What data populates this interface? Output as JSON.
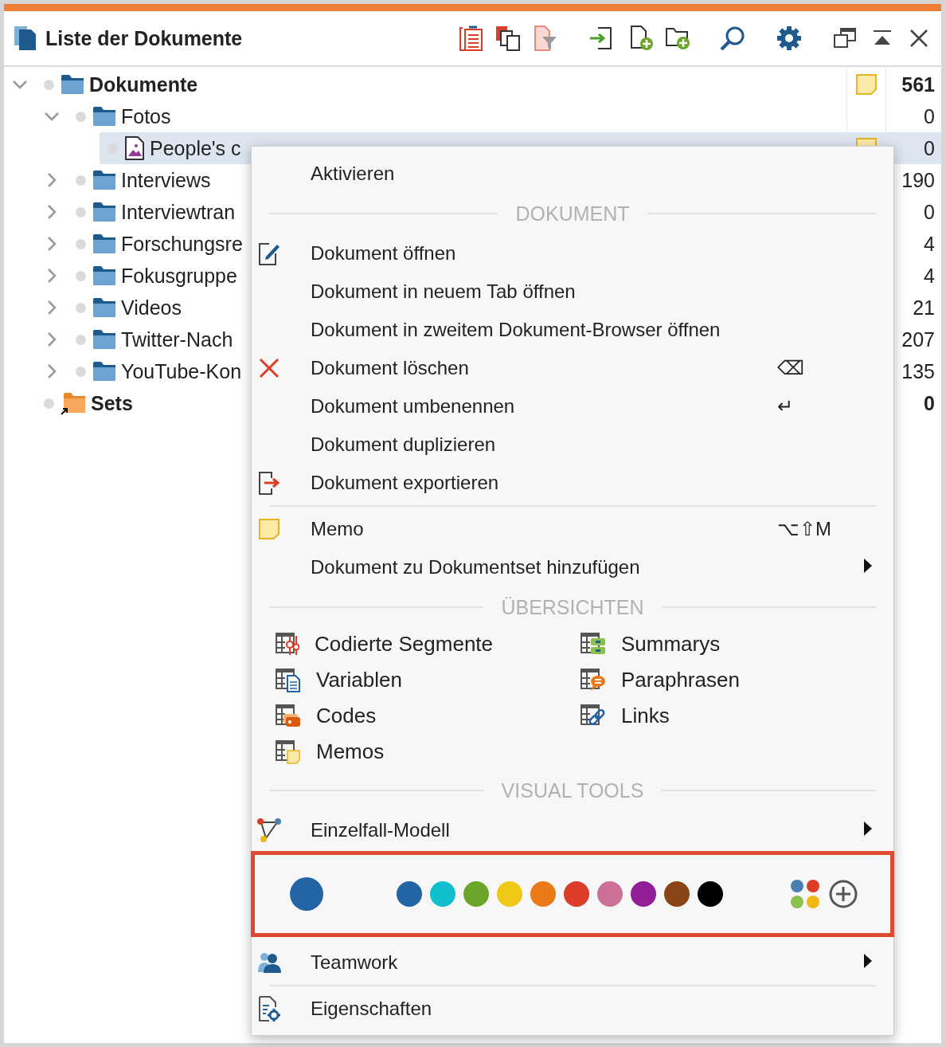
{
  "window": {
    "title": "Liste der Dokumente"
  },
  "tree": [
    {
      "kind": "folder",
      "label": "Dokumente",
      "count": "561",
      "memo": true,
      "expanded": true,
      "selected": false,
      "children": [
        {
          "kind": "folder",
          "label": "Fotos",
          "count": "0",
          "memo": false,
          "expanded": true,
          "selected": false,
          "children": [
            {
              "kind": "image",
              "label": "People's c",
              "count": "0",
              "memo": true,
              "selected": true
            }
          ]
        },
        {
          "kind": "folder",
          "label": "Interviews",
          "count": "190",
          "memo": false,
          "expanded": false,
          "selected": false
        },
        {
          "kind": "folder",
          "label": "Interviewtran",
          "count": "0",
          "memo": false,
          "expanded": false,
          "selected": false
        },
        {
          "kind": "folder",
          "label": "Forschungsre",
          "count": "4",
          "memo": false,
          "expanded": false,
          "selected": false
        },
        {
          "kind": "folder",
          "label": "Fokusgruppe",
          "count": "4",
          "memo": false,
          "expanded": false,
          "selected": false
        },
        {
          "kind": "folder",
          "label": "Videos",
          "count": "21",
          "memo": false,
          "expanded": false,
          "selected": false
        },
        {
          "kind": "folder",
          "label": "Twitter-Nach",
          "count": "207",
          "memo": false,
          "expanded": false,
          "selected": false
        },
        {
          "kind": "folder",
          "label": "YouTube-Kon",
          "count": "135",
          "memo": false,
          "expanded": false,
          "selected": false
        }
      ]
    },
    {
      "kind": "set",
      "label": "Sets",
      "count": "0",
      "memo": false,
      "selected": false
    }
  ],
  "menu": {
    "items": [
      {
        "kind": "item",
        "label": "Aktivieren"
      },
      {
        "kind": "heading",
        "label": "DOKUMENT"
      },
      {
        "kind": "item",
        "label": "Dokument öffnen"
      },
      {
        "kind": "item",
        "label": "Dokument in neuem Tab öffnen"
      },
      {
        "kind": "item",
        "label": "Dokument in zweitem Dokument-Browser öffnen"
      },
      {
        "kind": "item",
        "label": "Dokument löschen",
        "shortcut": "⌫"
      },
      {
        "kind": "item",
        "label": "Dokument umbenennen",
        "shortcut": "↵"
      },
      {
        "kind": "item",
        "label": "Dokument duplizieren"
      },
      {
        "kind": "item",
        "label": "Dokument exportieren"
      },
      {
        "kind": "separator"
      },
      {
        "kind": "item",
        "label": "Memo",
        "shortcut": "⌥⇧M"
      },
      {
        "kind": "item",
        "label": "Dokument zu Dokumentset hinzufügen",
        "submenu": true
      },
      {
        "kind": "heading",
        "label": "ÜBERSICHTEN"
      },
      {
        "kind": "grid",
        "entries": [
          {
            "label": "Codierte Segmente"
          },
          {
            "label": "Summarys"
          },
          {
            "label": "Variablen"
          },
          {
            "label": "Paraphrasen"
          },
          {
            "label": "Codes"
          },
          {
            "label": "Links"
          },
          {
            "label": "Memos"
          }
        ]
      },
      {
        "kind": "heading",
        "label": "VISUAL TOOLS"
      },
      {
        "kind": "item",
        "label": "Einzelfall-Modell",
        "submenu": true
      },
      {
        "kind": "colors",
        "highlighted": true,
        "current": {
          "color": "#2364a5"
        },
        "palette": [
          {
            "color": "#2364a5"
          },
          {
            "color": "#0fbfcc"
          },
          {
            "color": "#6ba52a"
          },
          {
            "color": "#efc815"
          },
          {
            "color": "#ea7a18"
          },
          {
            "color": "#dc3c28"
          },
          {
            "color": "#cc7097"
          },
          {
            "color": "#921e98"
          },
          {
            "color": "#8a4415"
          },
          {
            "color": "#000000"
          }
        ]
      },
      {
        "kind": "item",
        "label": "Teamwork",
        "submenu": true
      },
      {
        "kind": "separator"
      },
      {
        "kind": "item",
        "label": "Eigenschaften"
      }
    ]
  }
}
